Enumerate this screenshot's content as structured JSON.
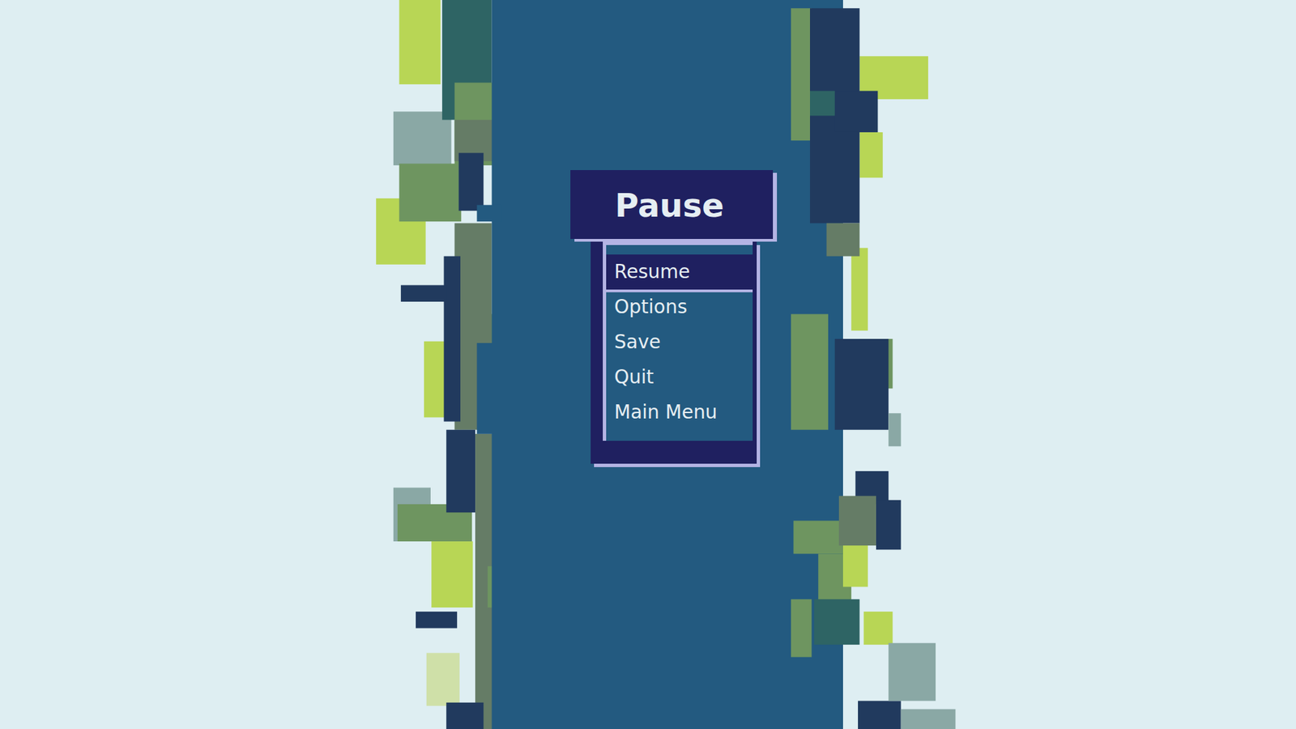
{
  "menu": {
    "title": "Pause",
    "items": [
      {
        "label": "Resume",
        "selected": true
      },
      {
        "label": "Options",
        "selected": false
      },
      {
        "label": "Save",
        "selected": false
      },
      {
        "label": "Quit",
        "selected": false
      },
      {
        "label": "Main Menu",
        "selected": false
      }
    ]
  }
}
